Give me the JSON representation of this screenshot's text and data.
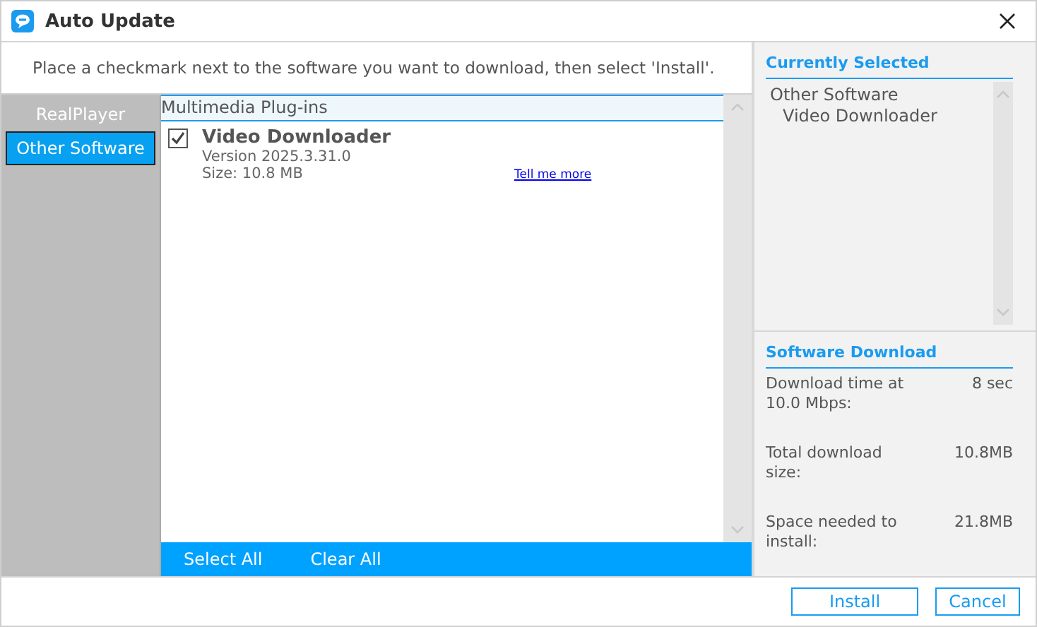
{
  "window": {
    "title": "Auto Update"
  },
  "instruction": "Place a checkmark next to the software you want to download, then select 'Install'.",
  "categories": [
    {
      "label": "RealPlayer",
      "selected": false
    },
    {
      "label": "Other Software",
      "selected": true
    }
  ],
  "list": {
    "group": "Multimedia Plug-ins",
    "items": [
      {
        "name": "Video Downloader",
        "checked": true,
        "version": "Version 2025.3.31.0",
        "size": "Size: 10.8 MB",
        "link": "Tell me more"
      }
    ],
    "actions": [
      "Select All",
      "Clear All"
    ]
  },
  "currently_selected": {
    "title": "Currently Selected",
    "items": [
      {
        "label": "Other Software",
        "children": [
          {
            "label": "Video Downloader"
          }
        ]
      }
    ]
  },
  "software_download": {
    "title": "Software Download",
    "rows": [
      {
        "label": "Download time at 10.0 Mbps:",
        "value": "8 sec"
      },
      {
        "label": "Total download size:",
        "value": "10.8MB"
      },
      {
        "label": "Space needed to install:",
        "value": "21.8MB"
      }
    ]
  },
  "buttons": [
    "Install",
    "Cancel"
  ]
}
